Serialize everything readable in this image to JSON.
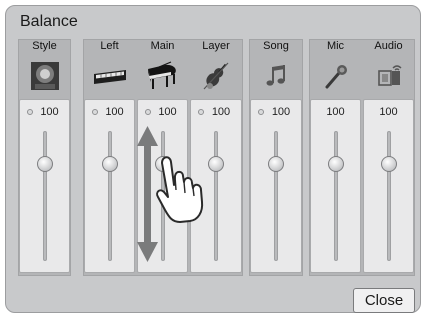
{
  "title": "Balance",
  "channels": [
    {
      "id": "style",
      "label": "Style",
      "value": "100",
      "icon": "speaker-icon",
      "led": true
    },
    {
      "id": "left",
      "label": "Left",
      "value": "100",
      "icon": "keyboard-icon",
      "led": true
    },
    {
      "id": "main",
      "label": "Main",
      "value": "100",
      "icon": "grand-piano-icon",
      "led": true
    },
    {
      "id": "layer",
      "label": "Layer",
      "value": "100",
      "icon": "violin-icon",
      "led": true
    },
    {
      "id": "song",
      "label": "Song",
      "value": "100",
      "icon": "music-note-icon",
      "led": true
    },
    {
      "id": "mic",
      "label": "Mic",
      "value": "100",
      "icon": "microphone-icon",
      "led": false
    },
    {
      "id": "audio",
      "label": "Audio",
      "value": "100",
      "icon": "audio-device-icon",
      "led": false
    }
  ],
  "close_label": "Close",
  "colors": {
    "panel": "#c8c9cb",
    "accent_arrow": "#777879",
    "hand": "#ffffff"
  }
}
